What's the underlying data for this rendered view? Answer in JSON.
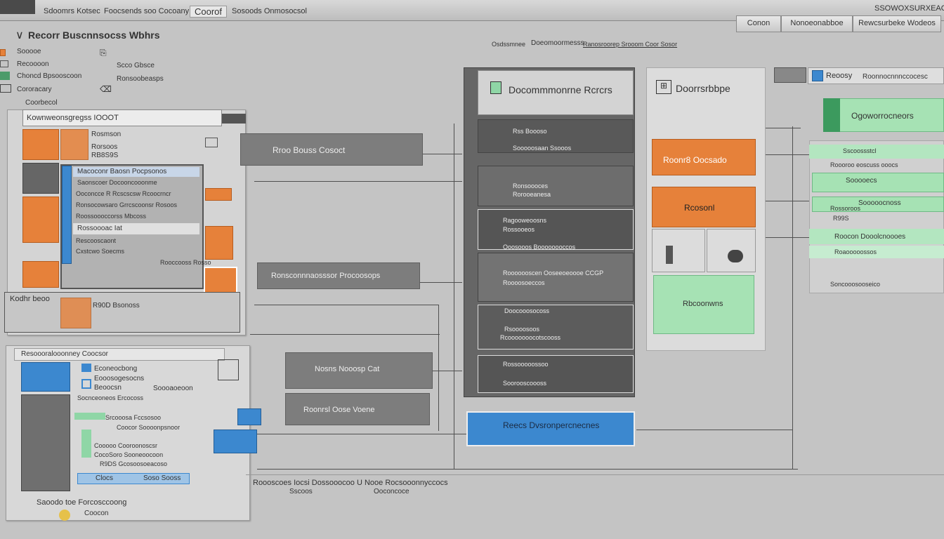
{
  "topbar": {
    "menu": [
      "Sdoomrs Kotsec",
      "Foocsends soo Cocoany",
      "Coorof",
      "Sosoods Onmosocsol"
    ],
    "right_title": "SSOWOXSURXEAOC"
  },
  "toolbar_buttons": [
    "Conon",
    "Nonoeonabboe",
    "Rewcsurbeke Wodeos"
  ],
  "left_panel": {
    "title": "Recorr Buscnnsocss Wbhrs",
    "items": [
      "Sooooe",
      "Recoooon",
      "Choncd Bpsooscoon",
      "Cororacary",
      "Coorbecol"
    ],
    "mini": [
      "Scco Gbsce",
      "Ronsoobeasps"
    ]
  },
  "breadcrumb_row": [
    "Osdssmnee",
    "Doeomoormesss",
    "Ranosroorep Srooom Coor Sosor"
  ],
  "list_panel": {
    "title": "Kownweonsgregss IOOOT",
    "lines": [
      "Rosmson",
      "Rorsoos",
      "RB8S9S"
    ],
    "nested_rows": [
      "Macoconr Baosn Pocpsonos",
      "Saonscoer Docooncooonme",
      "Ooconcce R Rcscscsw Rcoocrncr",
      "Ronsocowsaro Grrcscoonsr Rosoos",
      "Roossoooccorss Mbcoss",
      "Rossoooac Iat",
      "Rescooscaont",
      "Cxstcwo Soecms",
      "Rooccooss Rosso"
    ],
    "footer": "Kodhr beoo",
    "footer_right": "R90D Bsonoss"
  },
  "lower_left_panel": {
    "title": "Resoooralooonney Coocsor",
    "items": [
      "Econeocbong",
      "Eooosogesocns",
      "Beoocsn",
      "Soooaoeoon",
      "Socnceoneos Ercocoss",
      "Srcooosa Fccsosoo",
      "Coocor Soooonpsnoor",
      "Cooooo Cooroonoscsr",
      "CocoSoro Sooneoocoon",
      "R9DS Gcosoosoeacoso"
    ],
    "bottom_bar": [
      "Clocs",
      "Soso Sooss"
    ],
    "status": [
      "Saoodo toe Forcosccoong",
      "Coocon"
    ]
  },
  "connectors": {
    "box1": "Rroo Bouss Cosoct",
    "box2": "Ronsconnnaosssor Procoosops",
    "box3": "Nosns Nooosp Cat",
    "box4": "Roonrsl Oose Voene"
  },
  "doc_panel": {
    "title": "Docommmonrne Rcrcrs",
    "rows": [
      [
        "Rss Boooso",
        "Sooooosaan Ssooos"
      ],
      [
        "Ronsoooces",
        "Rorooeanesa"
      ],
      [
        "Ragooweoosns",
        "Rossooeos",
        "Ooosooos Boooooooccos"
      ],
      [
        "Rooooooscen Ooseeoeoooe CCGP",
        "Roooosoeccos"
      ],
      [
        "Doocooosocoss",
        "Rsoooosoos",
        "Rcooooooocotscooss"
      ],
      [
        "Rossooooossoo",
        "Soorooscoooss"
      ]
    ],
    "blue_button": "Reecs Dvsronpercnecnes"
  },
  "right_panel": {
    "title": "Doorrsrbbpe",
    "orange1": "Roonr8 Oocsado",
    "orange2": "Rcosonl",
    "green": "Rbcoonwns"
  },
  "far_right": {
    "header": "Reoosy",
    "header2": "Roonnocnnnccocesc",
    "green_top": "Ogoworrocneors",
    "rows": [
      "Sscoossstcl",
      "Roooroo eoscuss ooocs",
      "Sooooecs",
      "Sooooocnoss",
      "Rossoroos",
      "R99S",
      "Roocon Dooolcnoooes",
      "Roaooooossos"
    ],
    "footer": "Soncooosooseico"
  },
  "status_bar": {
    "text": "Roooscoes Iocsi Dossooocoo U Nooe Rocsooonnyccocs",
    "sub1": "Sscoos",
    "sub2": "Ooconcoce"
  },
  "colors": {
    "orange": "#e6813a",
    "green": "#a6e2b4",
    "blue": "#3c88cf",
    "dark": "#5a5a5a"
  }
}
